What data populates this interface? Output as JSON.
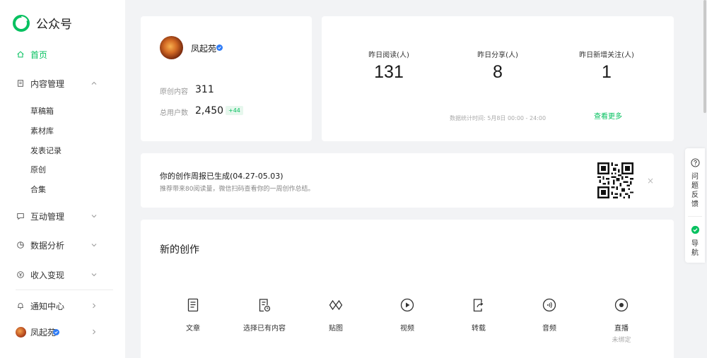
{
  "app": {
    "logo_text": "公众号",
    "accent": "#07c160"
  },
  "sidebar": {
    "home": "首页",
    "content": {
      "label": "内容管理",
      "items": [
        "草稿箱",
        "素材库",
        "发表记录",
        "原创",
        "合集"
      ]
    },
    "interaction": "互动管理",
    "analytics": "数据分析",
    "revenue": "收入变现",
    "notifications": "通知中心",
    "account_name": "凤起苑"
  },
  "profile": {
    "name": "凤起苑",
    "original_label": "原创内容",
    "original_value": "311",
    "users_label": "总用户数",
    "users_value": "2,450",
    "users_delta": "+44"
  },
  "stats": {
    "reads_label": "昨日阅读(人)",
    "reads_value": "131",
    "shares_label": "昨日分享(人)",
    "shares_value": "8",
    "follows_label": "昨日新增关注(人)",
    "follows_value": "1",
    "note": "数据统计时间: 5月8日 00:00 - 24:00",
    "see_more": "查看更多"
  },
  "report": {
    "title": "你的创作周报已生成(04.27-05.03)",
    "desc": "推荐带来80阅读量，微信扫码查看你的一周创作总结。",
    "close": "×"
  },
  "create": {
    "title": "新的创作",
    "tools": [
      {
        "label": "文章",
        "icon": "article-icon"
      },
      {
        "label": "选择已有内容",
        "icon": "existing-content-icon"
      },
      {
        "label": "贴图",
        "icon": "image-post-icon"
      },
      {
        "label": "视频",
        "icon": "video-icon"
      },
      {
        "label": "转载",
        "icon": "repost-icon"
      },
      {
        "label": "音频",
        "icon": "audio-icon"
      },
      {
        "label": "直播",
        "icon": "live-icon",
        "sub": "未绑定"
      }
    ]
  },
  "float_panel": {
    "feedback": "问题反馈",
    "guide": "导航"
  }
}
